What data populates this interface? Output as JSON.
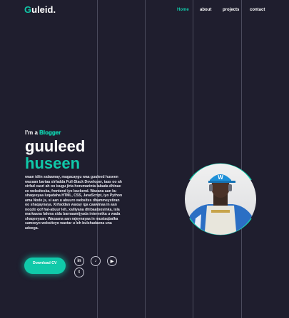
{
  "header": {
    "logo_first": "G",
    "logo_rest": "uleid."
  },
  "nav": {
    "home": "Home",
    "about": "about",
    "projects": "projects",
    "contact": "contact"
  },
  "hero": {
    "intro_prefix": "I'm a ",
    "intro_role": "Blogger",
    "first_name": "guuleed",
    "last_name": "huseen",
    "description": "waan idiin salaamay, magacaygu waa guuleed huseen waxaan bartaa xirfadda Full-Stack Developer, taas oo ah xirfad casri ah oo isugu jirta horumarinta labada dhinac ee websiteska, frontend iyo backend. Waxana aan ku shaqeeyaa luqadaha HTML, CSS, JavaScript, iyo Python ama Node js, si aan u abuuro websites dhammeystiran oo shaqaynaya. Xirfaddan waxay iga caawinaa in aan noqdo qof hal-abuur leh, xalliyana dhibaatooyinka, isla markaana fahma sida barnaamijyada internetka u wada shaqeeyaan. Waxaana aan rajeynayaa in mustaqbalka sameeyo websiteyo waxtar u leh bulshadaena una adeega.",
    "download_label": "Download CV"
  },
  "social": {
    "linkedin": "in",
    "tiktok": "♪",
    "youtube": "▶",
    "twitter": "t"
  },
  "colors": {
    "accent": "#10c9a9",
    "background": "#1f1e2e"
  },
  "icons": [
    "linkedin-icon",
    "tiktok-icon",
    "youtube-icon",
    "twitter-icon"
  ]
}
